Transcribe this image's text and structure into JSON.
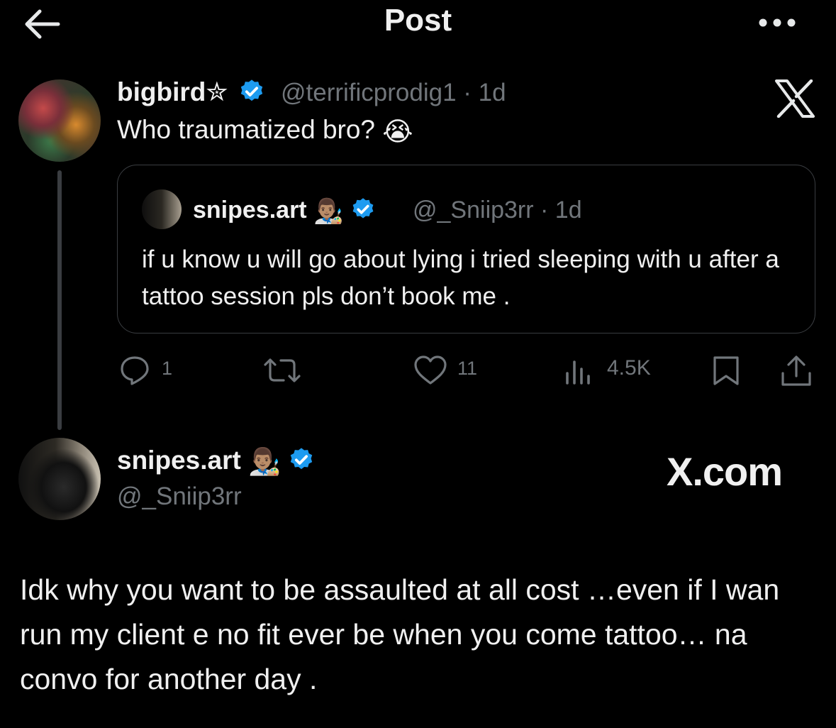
{
  "header": {
    "title": "Post"
  },
  "tweet1": {
    "name": "bigbird✮",
    "handle": "@terrificprodig1 · 1d",
    "text": "Who traumatized bro?",
    "emoji": "😭"
  },
  "quote": {
    "name": "snipes.art",
    "emoji": "👨🏽‍🎨",
    "handle": "@_Sniip3rr · 1d",
    "text": "if u know u will go about lying i tried sleeping with u after a tattoo session pls don’t book me ."
  },
  "actions": {
    "replies": "1",
    "likes": "11",
    "views": "4.5K"
  },
  "tweet2": {
    "name": "snipes.art",
    "emoji": "👨🏽‍🎨",
    "handle": "@_Sniip3rr",
    "brand": "X.com",
    "text": "Idk why you want to be assaulted at all cost …even if I wan run my client e no fit ever be when you come tattoo… na convo for another day ."
  },
  "colors": {
    "background": "#000000",
    "text": "#e7e9ea",
    "muted": "#71767b",
    "verified": "#1d9bf0",
    "border": "#3a3d41"
  },
  "icons": [
    "back-arrow-icon",
    "more-icon",
    "x-logo-icon",
    "verified-badge-icon",
    "reply-icon",
    "retweet-icon",
    "like-icon",
    "views-icon",
    "bookmark-icon",
    "share-icon"
  ]
}
